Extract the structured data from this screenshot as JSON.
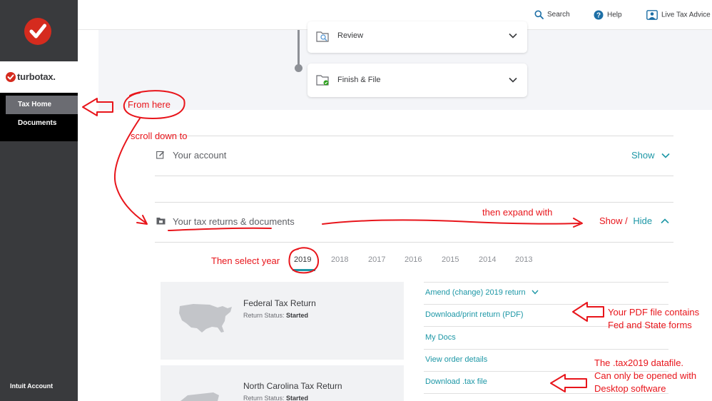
{
  "sidebar": {
    "brand": "turbotax.",
    "nav": [
      "Tax Home",
      "Documents"
    ],
    "footer": "Intuit Account"
  },
  "topbar": {
    "search": "Search",
    "help": "Help",
    "live": "Live Tax Advice"
  },
  "steps": [
    {
      "label": "Review"
    },
    {
      "label": "Finish & File"
    }
  ],
  "sections": {
    "account": {
      "title": "Your account",
      "toggle": "Show"
    },
    "returns": {
      "title": "Your tax returns & documents",
      "show": "Show /",
      "hide": "Hide"
    }
  },
  "years": [
    "2019",
    "2018",
    "2017",
    "2016",
    "2015",
    "2014",
    "2013"
  ],
  "returns": [
    {
      "title": "Federal Tax Return",
      "status_label": "Return Status:",
      "status_value": "Started"
    },
    {
      "title": "North Carolina Tax Return",
      "status_label": "Return Status:",
      "status_value": "Started"
    }
  ],
  "links": [
    "Amend (change) 2019 return",
    "Download/print return (PDF)",
    "My Docs",
    "View order details",
    "Download .tax file"
  ],
  "annotations": {
    "from_here": "From here",
    "scroll_down": "scroll down to",
    "expand": "then expand with",
    "select_year": "Then select year",
    "pdf_line1": "Your PDF file contains",
    "pdf_line2": "Fed and State forms",
    "tax_line1": "The .tax2019 datafile.",
    "tax_line2": "Can only be opened with",
    "tax_line3": "Desktop software"
  },
  "colors": {
    "brand_red": "#d52b1e",
    "teal": "#1d97a6",
    "annotation_red": "#e8151b",
    "sidebar": "#393a3d"
  }
}
